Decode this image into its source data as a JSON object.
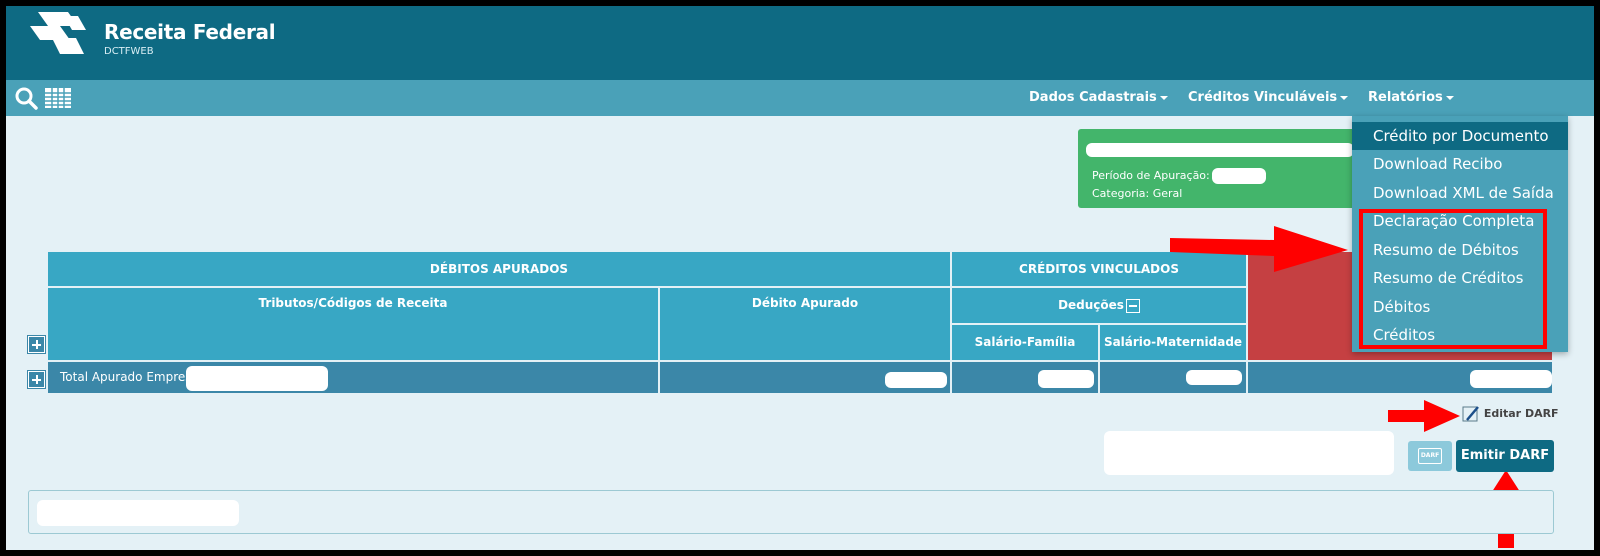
{
  "brand": {
    "title": "Receita Federal",
    "subtitle": "DCTFWEB"
  },
  "nav": {
    "items": [
      {
        "label": "Dados Cadastrais"
      },
      {
        "label": "Créditos Vinculáveis"
      },
      {
        "label": "Relatórios"
      }
    ]
  },
  "info": {
    "periodo_label": "Período de Apuração:",
    "categoria_label": "Categoria: Geral"
  },
  "dropdown": {
    "items": [
      {
        "label": "Crédito por Documento"
      },
      {
        "label": "Download Recibo"
      },
      {
        "label": "Download XML de Saída"
      },
      {
        "label": "Declaração Completa"
      },
      {
        "label": "Resumo de Débitos"
      },
      {
        "label": "Resumo de Créditos"
      },
      {
        "label": "Débitos"
      },
      {
        "label": "Créditos"
      }
    ]
  },
  "table": {
    "debitos_apurados": "DÉBITOS APURADOS",
    "creditos_vinculados": "CRÉDITOS VINCULADOS",
    "tributos": "Tributos/Códigos de Receita",
    "debito_apurado": "Débito Apurado",
    "deducoes": "Deduções",
    "salario_familia": "Salário-Família",
    "salario_maternidade": "Salário-Maternidade",
    "total_row_label": "Total Apurado Empresa"
  },
  "actions": {
    "editar_darf": "Editar DARF",
    "emitir_darf": "Emitir DARF",
    "darf_icon_text": "DARF"
  },
  "colors": {
    "header": "#0e6a83",
    "navbar": "#4aa1b8",
    "table_header": "#38a7c4",
    "table_total_row": "#3b87a8",
    "info_box": "#43b56b",
    "red_cell": "#c54042",
    "annotation_red": "#ff0000",
    "page_bg": "#e4f1f6"
  }
}
